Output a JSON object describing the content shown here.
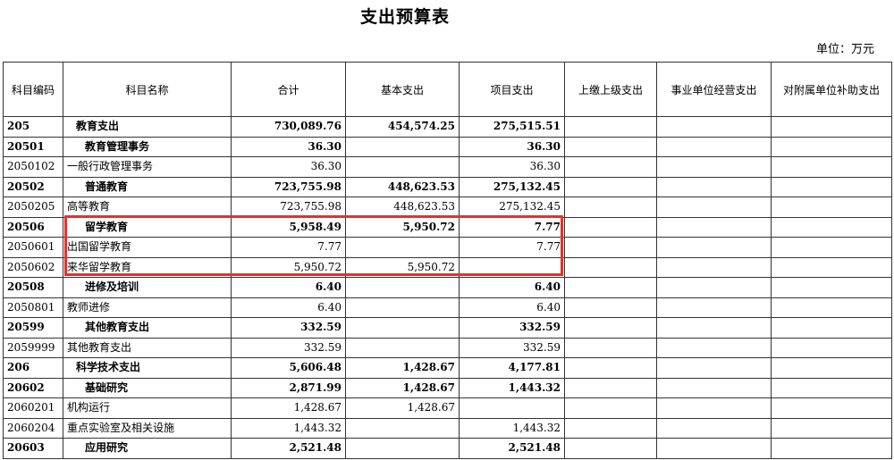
{
  "title": "支出预算表",
  "unit": "单位：万元",
  "highlight_color": "#e8302a",
  "columns": [
    "科目编码",
    "科目名称",
    "合计",
    "基本支出",
    "项目支出",
    "上缴上级支出",
    "事业单位经营支出",
    "对附属单位补助支出"
  ],
  "rows": [
    {
      "code": "205",
      "name": "教育支出",
      "total": "730,089.76",
      "basic": "454,574.25",
      "project": "275,515.51",
      "upper": "",
      "business": "",
      "subsidy": ""
    },
    {
      "code": "20501",
      "name": "教育管理事务",
      "total": "36.30",
      "basic": "",
      "project": "36.30",
      "upper": "",
      "business": "",
      "subsidy": ""
    },
    {
      "code": "2050102",
      "name": "一般行政管理事务",
      "total": "36.30",
      "basic": "",
      "project": "36.30",
      "upper": "",
      "business": "",
      "subsidy": ""
    },
    {
      "code": "20502",
      "name": "普通教育",
      "total": "723,755.98",
      "basic": "448,623.53",
      "project": "275,132.45",
      "upper": "",
      "business": "",
      "subsidy": ""
    },
    {
      "code": "2050205",
      "name": "高等教育",
      "total": "723,755.98",
      "basic": "448,623.53",
      "project": "275,132.45",
      "upper": "",
      "business": "",
      "subsidy": ""
    },
    {
      "code": "20506",
      "name": "留学教育",
      "total": "5,958.49",
      "basic": "5,950.72",
      "project": "7.77",
      "upper": "",
      "business": "",
      "subsidy": ""
    },
    {
      "code": "2050601",
      "name": "出国留学教育",
      "total": "7.77",
      "basic": "",
      "project": "7.77",
      "upper": "",
      "business": "",
      "subsidy": ""
    },
    {
      "code": "2050602",
      "name": "来华留学教育",
      "total": "5,950.72",
      "basic": "5,950.72",
      "project": "",
      "upper": "",
      "business": "",
      "subsidy": ""
    },
    {
      "code": "20508",
      "name": "进修及培训",
      "total": "6.40",
      "basic": "",
      "project": "6.40",
      "upper": "",
      "business": "",
      "subsidy": ""
    },
    {
      "code": "2050801",
      "name": "教师进修",
      "total": "6.40",
      "basic": "",
      "project": "6.40",
      "upper": "",
      "business": "",
      "subsidy": ""
    },
    {
      "code": "20599",
      "name": "其他教育支出",
      "total": "332.59",
      "basic": "",
      "project": "332.59",
      "upper": "",
      "business": "",
      "subsidy": ""
    },
    {
      "code": "2059999",
      "name": "其他教育支出",
      "total": "332.59",
      "basic": "",
      "project": "332.59",
      "upper": "",
      "business": "",
      "subsidy": ""
    },
    {
      "code": "206",
      "name": "科学技术支出",
      "total": "5,606.48",
      "basic": "1,428.67",
      "project": "4,177.81",
      "upper": "",
      "business": "",
      "subsidy": ""
    },
    {
      "code": "20602",
      "name": "基础研究",
      "total": "2,871.99",
      "basic": "1,428.67",
      "project": "1,443.32",
      "upper": "",
      "business": "",
      "subsidy": ""
    },
    {
      "code": "2060201",
      "name": "机构运行",
      "total": "1,428.67",
      "basic": "1,428.67",
      "project": "",
      "upper": "",
      "business": "",
      "subsidy": ""
    },
    {
      "code": "2060204",
      "name": "重点实验室及相关设施",
      "total": "1,443.32",
      "basic": "",
      "project": "1,443.32",
      "upper": "",
      "business": "",
      "subsidy": ""
    },
    {
      "code": "20603",
      "name": "应用研究",
      "total": "2,521.48",
      "basic": "",
      "project": "2,521.48",
      "upper": "",
      "business": "",
      "subsidy": ""
    }
  ]
}
